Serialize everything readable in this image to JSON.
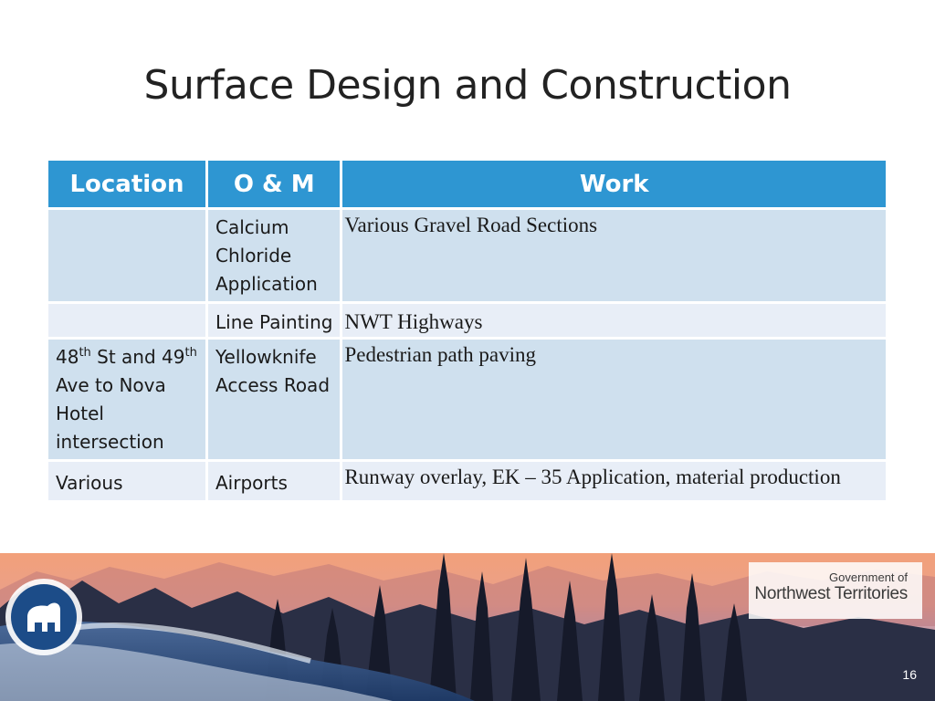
{
  "slide": {
    "title": "Surface Design and Construction",
    "page_number": "16"
  },
  "table": {
    "headers": [
      "Location",
      "O & M",
      "Work"
    ],
    "rows": [
      {
        "location": "",
        "om": "Calcium Chloride Application",
        "work": "Various Gravel Road Sections"
      },
      {
        "location": "",
        "om": "Line Painting",
        "work": "NWT Highways"
      },
      {
        "location_parts": [
          "48",
          "th",
          " St and 49",
          "th",
          " Ave to Nova Hotel intersection"
        ],
        "om": "Yellowknife Access Road",
        "work": "Pedestrian path paving"
      },
      {
        "location": "Various",
        "om": "Airports",
        "work": "Runway overlay, EK – 35 Application, material production"
      }
    ]
  },
  "logo": {
    "line1": "Government of",
    "line2": "Northwest Territories"
  }
}
